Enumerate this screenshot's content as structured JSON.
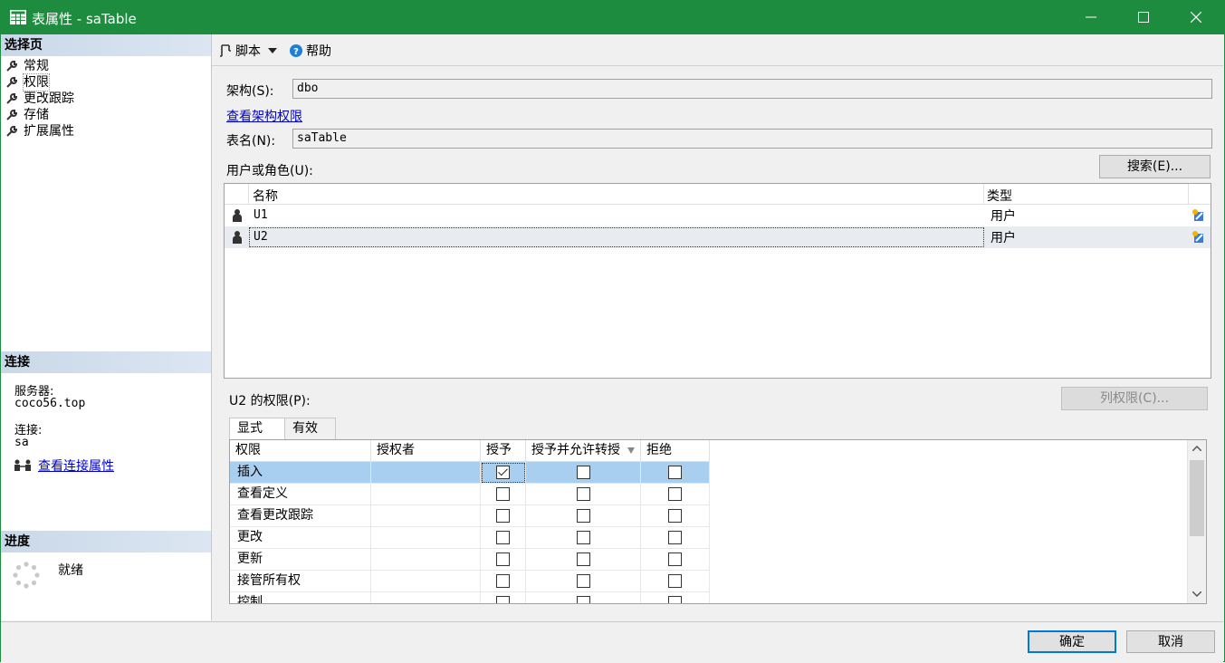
{
  "window": {
    "title": "表属性 - saTable"
  },
  "left": {
    "select_page_header": "选择页",
    "nav_items": [
      {
        "label": "常规"
      },
      {
        "label": "权限"
      },
      {
        "label": "更改跟踪"
      },
      {
        "label": "存储"
      },
      {
        "label": "扩展属性"
      }
    ],
    "connection_header": "连接",
    "server_label": "服务器:",
    "server_value": "coco56.top",
    "connection_label": "连接:",
    "connection_value": "sa",
    "view_connection_props": "查看连接属性",
    "progress_header": "进度",
    "progress_status": "就绪"
  },
  "toolbar": {
    "script_label": "脚本",
    "help_label": "帮助"
  },
  "form": {
    "schema_label": "架构(S):",
    "schema_value": "dbo",
    "view_schema_perms": "查看架构权限",
    "table_name_label": "表名(N):",
    "table_name_value": "saTable",
    "users_roles_label": "用户或角色(U):",
    "search_button": "搜索(E)..."
  },
  "principals": {
    "headers": {
      "name": "名称",
      "type": "类型"
    },
    "rows": [
      {
        "name": "U1",
        "type": "用户"
      },
      {
        "name": "U2",
        "type": "用户"
      }
    ]
  },
  "permissions": {
    "title": "U2 的权限(P):",
    "column_perms_button": "列权限(C)...",
    "tabs": [
      {
        "label": "显式"
      },
      {
        "label": "有效"
      }
    ],
    "headers": {
      "permission": "权限",
      "grantor": "授权者",
      "grant": "授予",
      "with_grant": "授予并允许转授",
      "deny": "拒绝"
    },
    "rows": [
      {
        "permission": "插入",
        "grantor": "",
        "grant": true,
        "with_grant": false,
        "deny": false
      },
      {
        "permission": "查看定义",
        "grantor": "",
        "grant": false,
        "with_grant": false,
        "deny": false
      },
      {
        "permission": "查看更改跟踪",
        "grantor": "",
        "grant": false,
        "with_grant": false,
        "deny": false
      },
      {
        "permission": "更改",
        "grantor": "",
        "grant": false,
        "with_grant": false,
        "deny": false
      },
      {
        "permission": "更新",
        "grantor": "",
        "grant": false,
        "with_grant": false,
        "deny": false
      },
      {
        "permission": "接管所有权",
        "grantor": "",
        "grant": false,
        "with_grant": false,
        "deny": false
      },
      {
        "permission": "控制",
        "grantor": "",
        "grant": false,
        "with_grant": false,
        "deny": false
      }
    ]
  },
  "footer": {
    "ok_label": "确定",
    "cancel_label": "取消"
  },
  "colors": {
    "titlebar": "#1e8c3e",
    "selected_row": "#a8cff0",
    "link": "#0000cc"
  },
  "icons": [
    "table-icon",
    "minimize-icon",
    "maximize-icon",
    "close-icon",
    "wrench-icon",
    "script-icon",
    "dropdown-arrow-icon",
    "help-icon",
    "connection-icon",
    "spinner-icon",
    "user-icon",
    "edit-principal-icon",
    "filter-icon",
    "scroll-up-icon",
    "scroll-down-icon"
  ]
}
